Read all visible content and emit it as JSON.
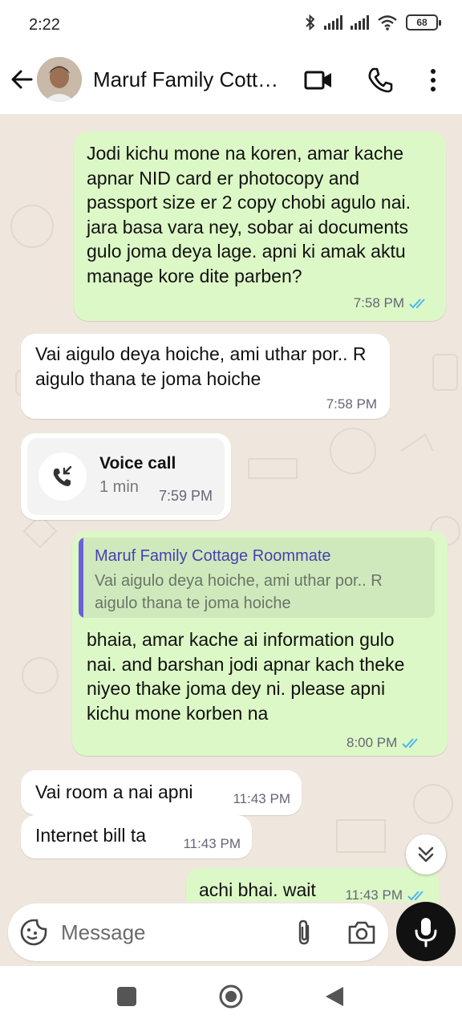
{
  "status_bar": {
    "time": "2:22",
    "battery": "68"
  },
  "header": {
    "title": "Maruf Family Cott…",
    "back_icon": "arrow-left-icon",
    "video_icon": "video-camera-icon",
    "call_icon": "phone-icon",
    "menu_icon": "kebab-menu-icon"
  },
  "messages": [
    {
      "direction": "outgoing",
      "text": "Jodi kichu mone na koren, amar kache apnar NID card er photocopy and passport size er 2 copy chobi agulo nai. jara basa vara ney, sobar ai documents gulo joma deya lage. apni ki amak aktu manage kore dite parben?",
      "time": "7:58 PM",
      "status": "read"
    },
    {
      "direction": "incoming",
      "text": "Vai aigulo deya hoiche, ami uthar por.. R aigulo thana te joma hoiche",
      "time": "7:58 PM"
    },
    {
      "direction": "incoming",
      "type": "call",
      "title": "Voice call",
      "duration": "1 min",
      "time": "7:59 PM"
    },
    {
      "direction": "outgoing",
      "quote": {
        "author": "Maruf Family Cottage Roommate",
        "text": "Vai aigulo deya hoiche, ami uthar por.. R aigulo thana te joma hoiche"
      },
      "text": "bhaia, amar kache ai information gulo nai. and barshan jodi apnar kach theke niyeo thake joma dey ni. please apni kichu mone korben na",
      "time": "8:00 PM",
      "status": "read"
    },
    {
      "direction": "incoming",
      "text": "Vai room a nai apni",
      "time": "11:43 PM"
    },
    {
      "direction": "incoming",
      "text": "Internet bill ta",
      "time": "11:43 PM"
    },
    {
      "direction": "outgoing",
      "text": "achi bhai. wait",
      "time": "11:43 PM",
      "status": "read"
    }
  ],
  "composer": {
    "placeholder": "Message",
    "emoji_icon": "sticker-icon",
    "attach_icon": "paperclip-icon",
    "camera_icon": "camera-icon",
    "mic_icon": "microphone-icon"
  },
  "colors": {
    "outgoing_bubble": "#dcf8c6",
    "incoming_bubble": "#ffffff",
    "read_ticks": "#4fb6ec",
    "quote_bar": "#6c5fd8",
    "chat_bg": "#efe7dd"
  }
}
